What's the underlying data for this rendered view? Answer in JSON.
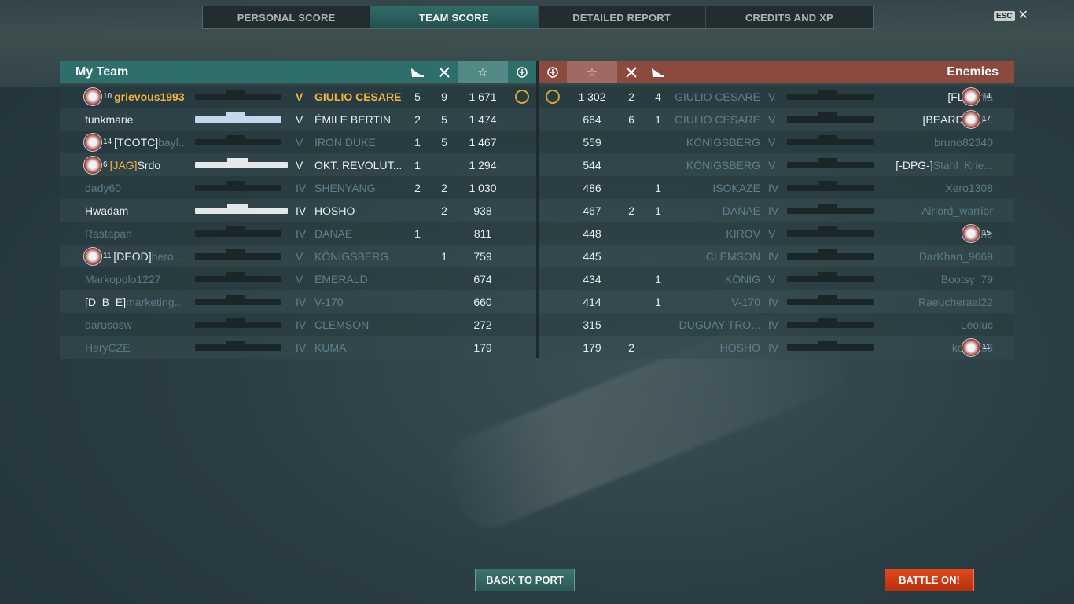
{
  "tabs": [
    "PERSONAL SCORE",
    "TEAM SCORE",
    "DETAILED REPORT",
    "CREDITS AND XP"
  ],
  "active_tab": 1,
  "esc_label": "ESC",
  "close_icon": "✕",
  "my_team": {
    "title": "My Team",
    "header_icons": [
      "planes-icon",
      "kills-icon",
      "star-icon",
      "medal-icon"
    ],
    "rows": [
      {
        "rank": "10",
        "name": "grievous1993",
        "tier": "V",
        "ship": "GIULIO CESARE",
        "planes": "5",
        "kills": "9",
        "score": "1 671",
        "medal": true,
        "style": "self",
        "sil": "dark"
      },
      {
        "rank": "",
        "name": "funkmarie",
        "tier": "V",
        "ship": "ÉMILE BERTIN",
        "planes": "2",
        "kills": "5",
        "score": "1 474",
        "medal": false,
        "style": "alive",
        "sil": "lightblue"
      },
      {
        "rank": "14",
        "name": "[TCOTC]",
        "name_dim": "bayl...",
        "tier": "V",
        "ship": "IRON DUKE",
        "planes": "1",
        "kills": "5",
        "score": "1 467",
        "medal": false,
        "style": "dead-partial",
        "sil": "dark"
      },
      {
        "rank": "6",
        "name": "Srdo",
        "clan": "[JAG]",
        "tier": "V",
        "ship": "OKT. REVOLUT...",
        "planes": "1",
        "kills": "",
        "score": "1 294",
        "medal": false,
        "style": "alive",
        "sil": "white"
      },
      {
        "rank": "",
        "name": "dady60",
        "tier": "IV",
        "ship": "SHENYANG",
        "planes": "2",
        "kills": "2",
        "score": "1 030",
        "medal": false,
        "style": "dead",
        "sil": "dark"
      },
      {
        "rank": "",
        "name": "Hwadam",
        "tier": "IV",
        "ship": "HOSHO",
        "planes": "",
        "kills": "2",
        "score": "938",
        "medal": false,
        "style": "alive",
        "sil": "white"
      },
      {
        "rank": "",
        "name": "Rastapan",
        "tier": "IV",
        "ship": "DANAE",
        "planes": "1",
        "kills": "",
        "score": "811",
        "medal": false,
        "style": "dead",
        "sil": "dark"
      },
      {
        "rank": "11",
        "name": "[DEOD]",
        "name_dim": "hero...",
        "tier": "V",
        "ship": "KÖNIGSBERG",
        "planes": "",
        "kills": "1",
        "score": "759",
        "medal": false,
        "style": "dead-partial",
        "sil": "dark"
      },
      {
        "rank": "",
        "name": "Markopolo1227",
        "tier": "V",
        "ship": "EMERALD",
        "planes": "",
        "kills": "",
        "score": "674",
        "medal": false,
        "style": "dead",
        "sil": "dark"
      },
      {
        "rank": "",
        "name": "[D_B_E]",
        "name_dim": "marketing...",
        "tier": "IV",
        "ship": "V-170",
        "planes": "",
        "kills": "",
        "score": "660",
        "medal": false,
        "style": "dead-partial",
        "sil": "dark"
      },
      {
        "rank": "",
        "name": "darusosw",
        "tier": "IV",
        "ship": "CLEMSON",
        "planes": "",
        "kills": "",
        "score": "272",
        "medal": false,
        "style": "dead",
        "sil": "dark"
      },
      {
        "rank": "",
        "name": "HeryCZE",
        "tier": "IV",
        "ship": "KUMA",
        "planes": "",
        "kills": "",
        "score": "179",
        "medal": false,
        "style": "dead",
        "sil": "dark"
      }
    ]
  },
  "enemies": {
    "title": "Enemies",
    "rows": [
      {
        "medal": true,
        "score": "1 302",
        "kills": "2",
        "planes": "4",
        "ship": "GIULIO CESARE",
        "tier": "V",
        "clan": "[FL]",
        "name": "kania",
        "rank": "14"
      },
      {
        "medal": false,
        "score": "664",
        "kills": "6",
        "planes": "1",
        "ship": "GIULIO CESARE",
        "tier": "V",
        "clan": "[BEARD]",
        "name": "Bru...",
        "rank": "17"
      },
      {
        "medal": false,
        "score": "559",
        "kills": "",
        "planes": "",
        "ship": "KÖNIGSBERG",
        "tier": "V",
        "clan": "",
        "name": "bruno82340",
        "rank": ""
      },
      {
        "medal": false,
        "score": "544",
        "kills": "",
        "planes": "",
        "ship": "KÖNIGSBERG",
        "tier": "V",
        "clan": "[-DPG-]",
        "name": "Stahl_Krie...",
        "rank": ""
      },
      {
        "medal": false,
        "score": "486",
        "kills": "",
        "planes": "1",
        "ship": "ISOKAZE",
        "tier": "IV",
        "clan": "",
        "name": "Xero1308",
        "rank": ""
      },
      {
        "medal": false,
        "score": "467",
        "kills": "2",
        "planes": "1",
        "ship": "DANAE",
        "tier": "IV",
        "clan": "",
        "name": "Airlord_warrior",
        "rank": ""
      },
      {
        "medal": false,
        "score": "448",
        "kills": "",
        "planes": "",
        "ship": "KIROV",
        "tier": "V",
        "clan": "",
        "name": "juche",
        "rank": "15"
      },
      {
        "medal": false,
        "score": "445",
        "kills": "",
        "planes": "",
        "ship": "CLEMSON",
        "tier": "IV",
        "clan": "",
        "name": "DarKhan_9669",
        "rank": ""
      },
      {
        "medal": false,
        "score": "434",
        "kills": "",
        "planes": "1",
        "ship": "KÖNIG",
        "tier": "V",
        "clan": "",
        "name": "Bootsy_79",
        "rank": ""
      },
      {
        "medal": false,
        "score": "414",
        "kills": "",
        "planes": "1",
        "ship": "V-170",
        "tier": "IV",
        "clan": "",
        "name": "Raeucheraal22",
        "rank": ""
      },
      {
        "medal": false,
        "score": "315",
        "kills": "",
        "planes": "",
        "ship": "DUGUAY-TRO...",
        "tier": "IV",
        "clan": "",
        "name": "Leoluc",
        "rank": ""
      },
      {
        "medal": false,
        "score": "179",
        "kills": "2",
        "planes": "",
        "ship": "HOSHO",
        "tier": "IV",
        "clan": "",
        "name": "konpits6",
        "rank": "11"
      }
    ]
  },
  "buttons": {
    "back": "BACK TO PORT",
    "battle": "BATTLE ON!"
  },
  "colors": {
    "my_team": "#2e6f6b",
    "enemies": "#8c4a3e",
    "self": "#f0b540",
    "battle_button": "#d63d16"
  }
}
